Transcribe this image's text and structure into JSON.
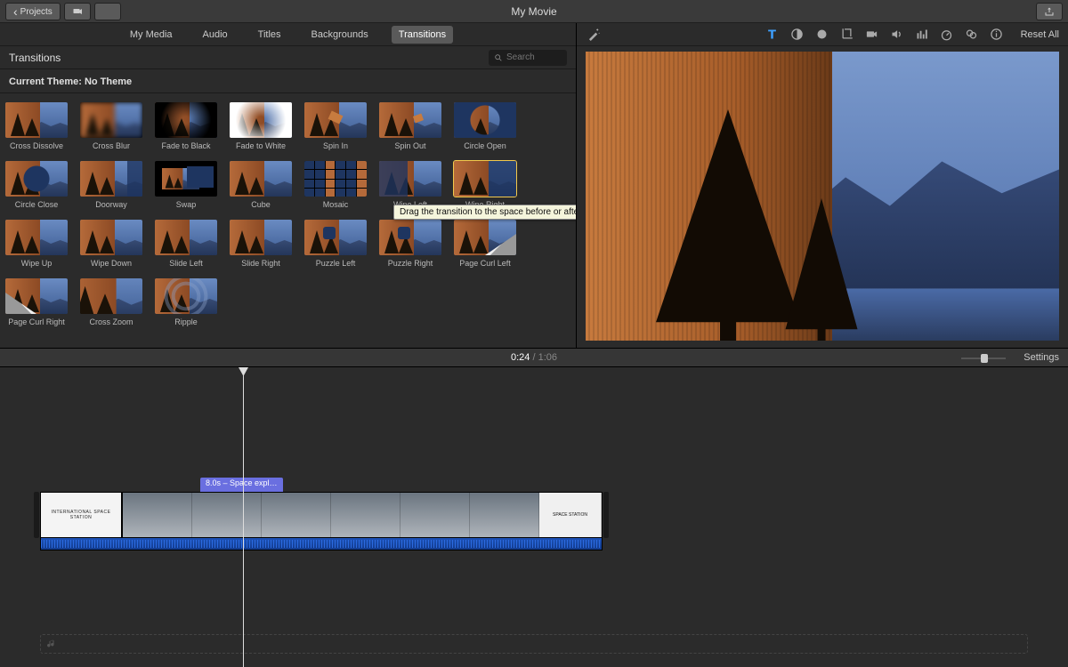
{
  "titlebar": {
    "title": "My Movie",
    "projects_label": "Projects"
  },
  "browser": {
    "tabs": [
      "My Media",
      "Audio",
      "Titles",
      "Backgrounds",
      "Transitions"
    ],
    "active_tab": 4,
    "heading": "Transitions",
    "search_placeholder": "Search",
    "theme_line": "Current Theme: No Theme",
    "tooltip_text": "Drag the transition to the space before or after a clip",
    "transitions": [
      "Cross Dissolve",
      "Cross Blur",
      "Fade to Black",
      "Fade to White",
      "Spin In",
      "Spin Out",
      "Circle Open",
      "Circle Close",
      "Doorway",
      "Swap",
      "Cube",
      "Mosaic",
      "Wipe Left",
      "Wipe Right",
      "Wipe Up",
      "Wipe Down",
      "Slide Left",
      "Slide Right",
      "Puzzle Left",
      "Puzzle Right",
      "Page Curl Left",
      "Page Curl Right",
      "Cross Zoom",
      "Ripple"
    ]
  },
  "preview": {
    "reset_label": "Reset All",
    "tools": [
      "magic-wand-icon",
      "text-icon",
      "color-balance-icon",
      "color-wheel-icon",
      "crop-icon",
      "camera-icon",
      "volume-icon",
      "equalizer-icon",
      "speed-icon",
      "filter-icon",
      "info-icon"
    ]
  },
  "timeline": {
    "current": "0:24",
    "total": "1:06",
    "settings_label": "Settings",
    "clip_tag": "8.0s – Space expl…",
    "title_clip_text": "INTERNATIONAL SPACE STATION",
    "end_clip_text": "SPACE STATION"
  }
}
